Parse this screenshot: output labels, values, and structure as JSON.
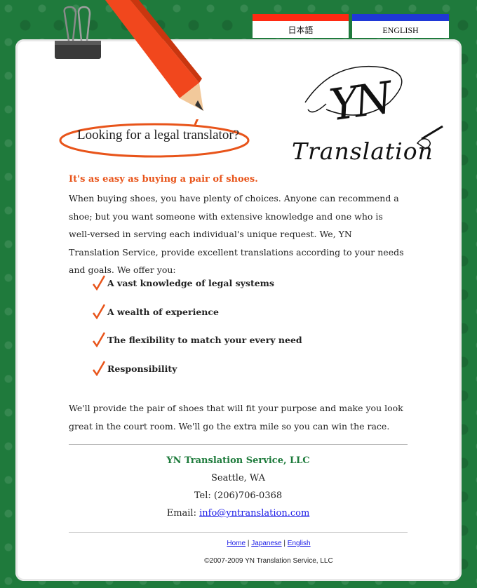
{
  "lang_tabs": {
    "japanese": "日本語",
    "english": "ENGLISH"
  },
  "hero": {
    "bubble_text": "Looking for a legal translator?"
  },
  "logo": {
    "monogram": "YN",
    "wordmark": "Translation"
  },
  "main": {
    "headline": "It's as easy as buying a pair of shoes.",
    "intro": "When buying shoes, you have plenty of choices. Anyone can recommend a shoe; but you want someone with extensive knowledge and one who is well-versed in serving each individual's unique request. We, YN Translation Service, provide excellent translations according to your needs and goals. We offer you:",
    "bullets": [
      "A vast knowledge of legal systems",
      "A wealth of experience",
      "The flexibility to match your every need",
      "Responsibility"
    ],
    "outro": "We'll provide the pair of shoes that will fit your purpose and make you look great in the court room. We'll go the extra mile so you can win the race."
  },
  "contact": {
    "company": "YN Translation Service, LLC",
    "city": "Seattle, WA",
    "tel": "Tel: (206)706-0368",
    "email_label": "Email:",
    "email": "info@yntranslation.com"
  },
  "footer": {
    "nav": [
      "Home",
      "Japanese",
      "English"
    ],
    "separator": "|",
    "copyright": "©2007-2009 YN Translation Service, LLC"
  },
  "colors": {
    "accent_orange": "#e8541a",
    "brand_green": "#1c7a3a",
    "jp_tab": "#ff2a12",
    "en_tab": "#1f38d6",
    "link": "#1a1ae6"
  }
}
